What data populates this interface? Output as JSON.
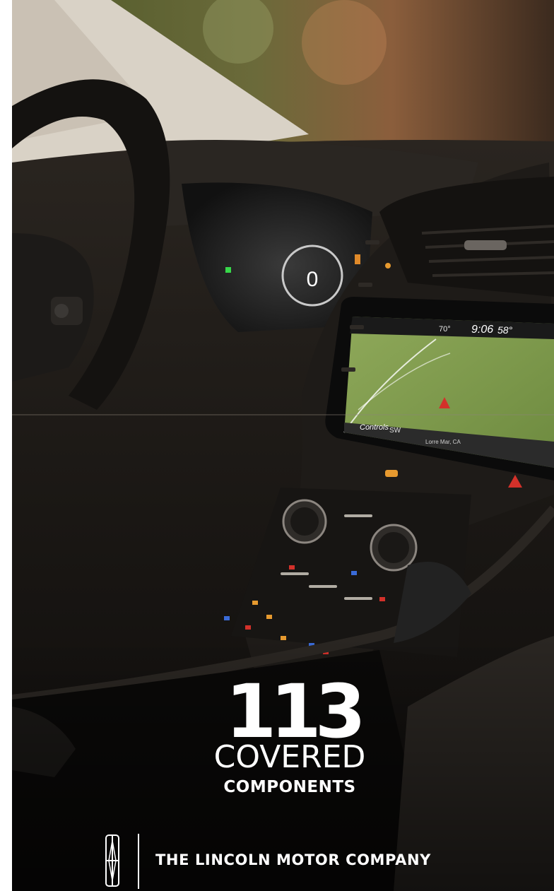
{
  "headline": {
    "count": "113",
    "line1": "COVERED",
    "line2": "COMPONENTS"
  },
  "footer": {
    "company": "THE LINCOLN MOTOR COMPANY",
    "logo": "lincoln-star-logo"
  },
  "screen": {
    "temperature_outside": "70°",
    "clock": "9:06",
    "temperature_cabin": "58°",
    "tab_controls": "Controls",
    "tab_sw": "SW",
    "location": "Lorre Mar, CA"
  },
  "cluster": {
    "speed": "0"
  },
  "colors": {
    "text": "#ffffff",
    "map_green": "#7d9a4a",
    "accent_orange": "#e79a2f",
    "accent_red": "#d3312a"
  }
}
